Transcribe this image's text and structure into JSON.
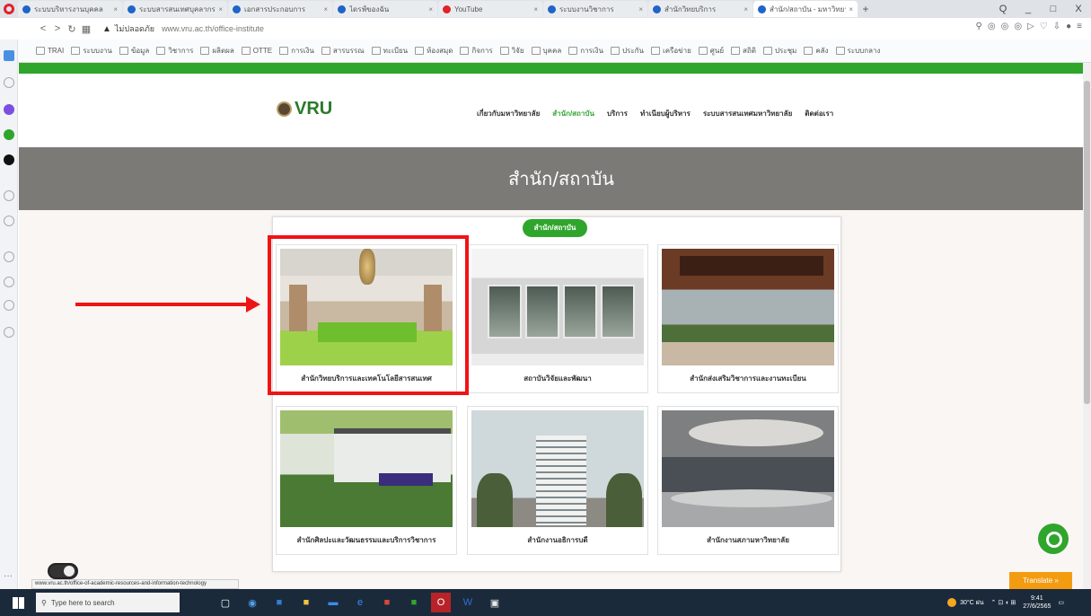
{
  "browser": {
    "tabs": [
      {
        "label": "ระบบบริหารงานบุคคล",
        "active": false
      },
      {
        "label": "ระบบสารสนเทศบุคลากร",
        "active": false
      },
      {
        "label": "เอกสารประกอบการ",
        "active": false
      },
      {
        "label": "ไดรฟ์ของฉัน",
        "active": false
      },
      {
        "label": "YouTube",
        "active": false
      },
      {
        "label": "ระบบงานวิชาการ",
        "active": false
      },
      {
        "label": "สำนักวิทยบริการ",
        "active": false
      },
      {
        "label": "สำนัก/สถาบัน - มหาวิทยาลัย",
        "active": true
      }
    ],
    "new_tab": "+",
    "window_controls": [
      "Q",
      "_",
      "□",
      "X"
    ],
    "address": {
      "secure_label": "ไม่ปลอดภัย",
      "url": "www.vru.ac.th/office-institute"
    },
    "bookmarks": [
      "TRAI",
      "ระบบงาน",
      "ข้อมูล",
      "วิชาการ",
      "ผลิตผล",
      "OTTE",
      "การเงิน",
      "สารบรรณ",
      "ทะเบียน",
      "ห้องสมุด",
      "กิจการ",
      "วิจัย",
      "บุคคล",
      "การเงิน",
      "ประกัน",
      "เครือข่าย",
      "ศูนย์",
      "สถิติ",
      "ประชุม",
      "คลัง",
      "ระบบกลาง"
    ]
  },
  "site": {
    "logo_text": "VRU",
    "menu": [
      {
        "label": "เกี่ยวกับมหาวิทยาลัย",
        "active": false
      },
      {
        "label": "สำนัก/สถาบัน",
        "active": true
      },
      {
        "label": "บริการ",
        "active": false
      },
      {
        "label": "ทำเนียบผู้บริหาร",
        "active": false
      },
      {
        "label": "ระบบสารสนเทศมหาวิทยาลัย",
        "active": false
      },
      {
        "label": "ติดต่อเรา",
        "active": false
      }
    ],
    "banner_title": "สำนัก/สถาบัน",
    "section_pill": "สำนัก/สถาบัน",
    "cards": [
      {
        "caption": "สำนักวิทยบริการและเทคโนโลยีสารสนเทศ",
        "art": "lobby"
      },
      {
        "caption": "สถาบันวิจัยและพัฒนา",
        "art": "office"
      },
      {
        "caption": "สำนักส่งเสริมวิชาการและงานทะเบียน",
        "art": "service-counter"
      },
      {
        "caption": "สำนักศิลปะและวัฒนธรรมและบริการวิชาการ",
        "art": "building-garden"
      },
      {
        "caption": "สำนักงานอธิการบดี",
        "art": "tower"
      },
      {
        "caption": "สำนักงานสภามหาวิทยาลัย",
        "art": "meeting-room"
      }
    ],
    "status_url": "www.vru.ac.th/office-of-academic-resources-and-information-technology",
    "translate_label": "Translate »"
  },
  "taskbar": {
    "search_placeholder": "Type here to search",
    "weather": "30°C ฝน",
    "time": "9:41",
    "date": "27/6/2565"
  },
  "colors": {
    "brand_green": "#2fa52c",
    "banner_gray": "#7c7a77",
    "highlight_red": "#ef1414"
  }
}
